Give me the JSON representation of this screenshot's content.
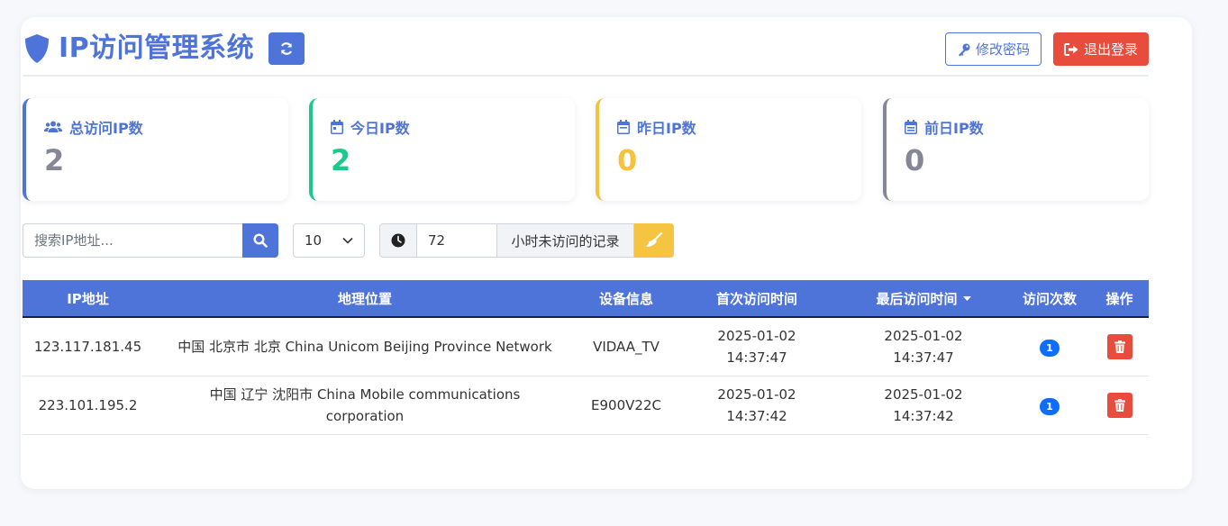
{
  "header": {
    "title": "IP访问管理系统",
    "change_password_label": "修改密码",
    "logout_label": "退出登录"
  },
  "stats": [
    {
      "label": "总访问IP数",
      "value": "2",
      "color": "#4f74d9",
      "value_color": "#858796",
      "icon": "users-icon"
    },
    {
      "label": "今日IP数",
      "value": "2",
      "color": "#1cc88a",
      "value_color": "#1cc88a",
      "icon": "calendar-icon"
    },
    {
      "label": "昨日IP数",
      "value": "0",
      "color": "#f6c23e",
      "value_color": "#f6c23e",
      "icon": "calendar-icon"
    },
    {
      "label": "前日IP数",
      "value": "0",
      "color": "#858796",
      "value_color": "#858796",
      "icon": "calendar-icon"
    }
  ],
  "toolbar": {
    "search_placeholder": "搜索IP地址...",
    "page_size": "10",
    "hours_value": "72",
    "hours_suffix": "小时未访问的记录"
  },
  "table": {
    "columns": [
      "IP地址",
      "地理位置",
      "设备信息",
      "首次访问时间",
      "最后访问时间",
      "访问次数",
      "操作"
    ],
    "rows": [
      {
        "ip": "123.117.181.45",
        "location": "中国 北京市 北京 China Unicom Beijing Province Network",
        "device": "VIDAA_TV",
        "first_date": "2025-01-02",
        "first_time": "14:37:47",
        "last_date": "2025-01-02",
        "last_time": "14:37:47",
        "count": "1"
      },
      {
        "ip": "223.101.195.2",
        "location_line1": "中国 辽宁 沈阳市 China Mobile communications",
        "location_line2": "corporation",
        "device": "E900V22C",
        "first_date": "2025-01-02",
        "first_time": "14:37:42",
        "last_date": "2025-01-02",
        "last_time": "14:37:42",
        "count": "1"
      }
    ]
  },
  "colors": {
    "primary": "#4f74d9",
    "danger": "#e74c3c",
    "warning": "#f5c542",
    "badge": "#0d6efd"
  }
}
